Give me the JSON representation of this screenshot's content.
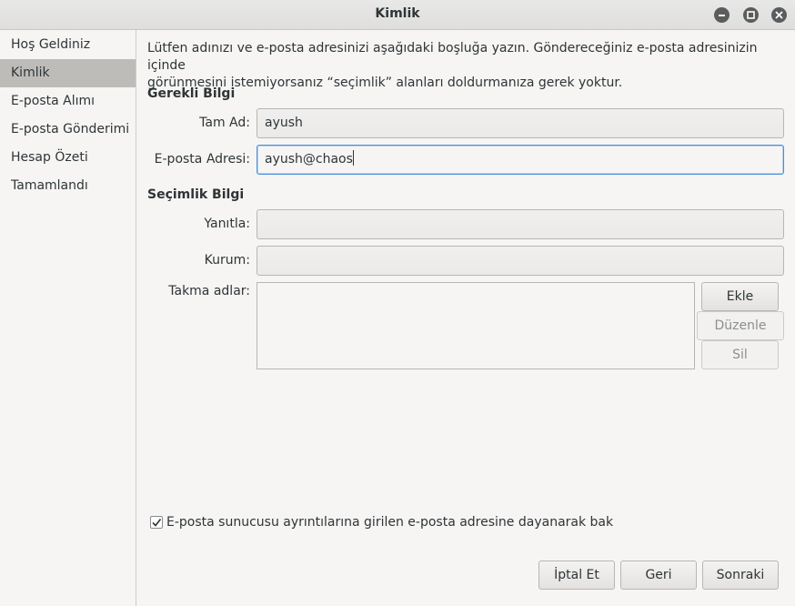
{
  "window": {
    "title": "Kimlik"
  },
  "sidebar": {
    "items": [
      {
        "label": "Hoş Geldiniz"
      },
      {
        "label": "Kimlik"
      },
      {
        "label": "E-posta Alımı"
      },
      {
        "label": "E-posta Gönderimi"
      },
      {
        "label": "Hesap Özeti"
      },
      {
        "label": "Tamamlandı"
      }
    ],
    "selected_label": "Kimlik"
  },
  "intro": {
    "line1": "Lütfen adınızı ve e-posta adresinizi aşağıdaki boşluğa yazın. Göndereceğiniz e-posta adresinizin içinde",
    "line2": "görünmesini istemiyorsanız “seçimlik” alanları doldurmanıza gerek yoktur."
  },
  "required": {
    "title": "Gerekli Bilgi",
    "full_name_label": "Tam Ad:",
    "full_name_value": "ayush",
    "email_label": "E-posta Adresi:",
    "email_value": "ayush@chaos"
  },
  "optional": {
    "title": "Seçimlik Bilgi",
    "reply_to_label": "Yanıtla:",
    "reply_to_value": "",
    "organization_label": "Kurum:",
    "organization_value": "",
    "aliases_label": "Takma adlar:",
    "add_label": "Ekle",
    "edit_label": "Düzenle",
    "remove_label": "Sil"
  },
  "lookup": {
    "label": "E-posta sunucusu ayrıntılarına girilen e-posta adresine dayanarak bak",
    "checked": true
  },
  "footer": {
    "cancel_label": "İptal Et",
    "back_label": "Geri",
    "next_label": "Sonraki"
  },
  "icons": {
    "minimize": "minimize-icon",
    "maximize": "maximize-icon",
    "close": "close-icon",
    "check": "checkmark-icon"
  },
  "colors": {
    "selection": "#bdbcb9",
    "focus_border": "#4a90d9",
    "window_button": "#5a5d5e"
  }
}
